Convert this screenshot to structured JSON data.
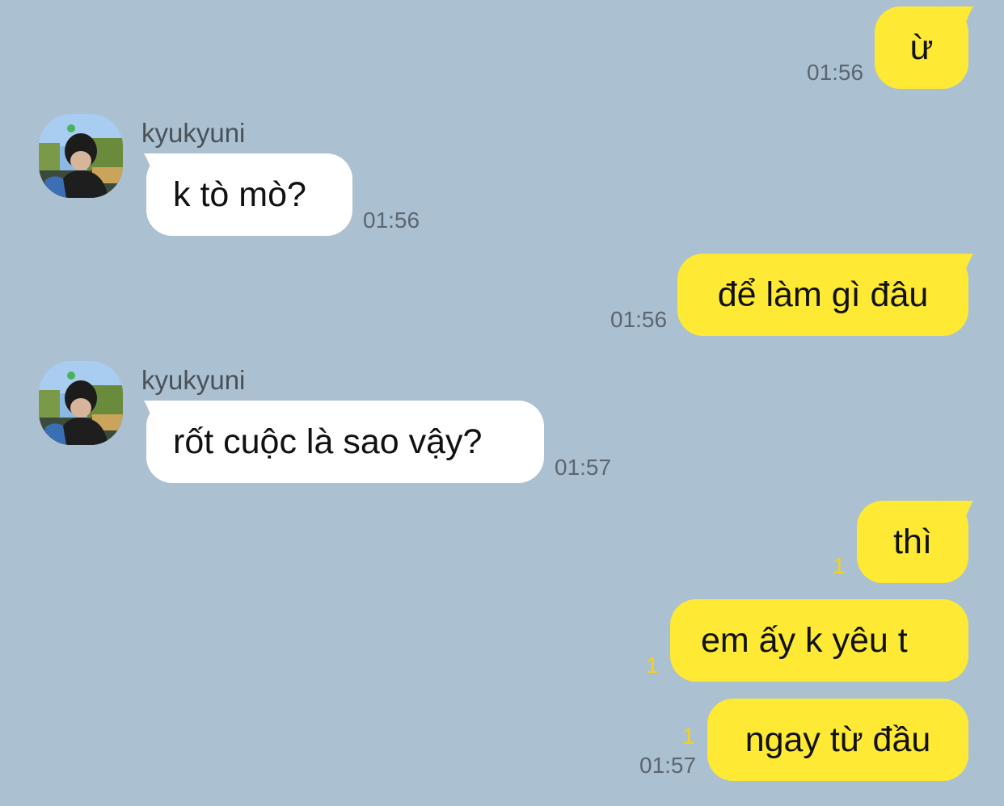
{
  "colors": {
    "background": "#abc1d1",
    "outgoing_bubble": "#fee934",
    "incoming_bubble": "#ffffff",
    "timestamp": "#5b6670",
    "unread_count": "#f2d21e"
  },
  "messages": [
    {
      "direction": "outgoing",
      "text": "ừ",
      "time": "01:56"
    },
    {
      "direction": "incoming",
      "sender": "kyukyuni",
      "text": "k tò mò?",
      "time": "01:56"
    },
    {
      "direction": "outgoing",
      "text": "để làm gì đâu",
      "time": "01:56"
    },
    {
      "direction": "incoming",
      "sender": "kyukyuni",
      "text": "rốt cuộc là sao vậy?",
      "time": "01:57"
    },
    {
      "direction": "outgoing",
      "text": "thì",
      "unread": "1"
    },
    {
      "direction": "outgoing",
      "text": "em ấy k yêu t",
      "unread": "1"
    },
    {
      "direction": "outgoing",
      "text": "ngay từ đầu",
      "unread": "1",
      "time": "01:57"
    }
  ]
}
